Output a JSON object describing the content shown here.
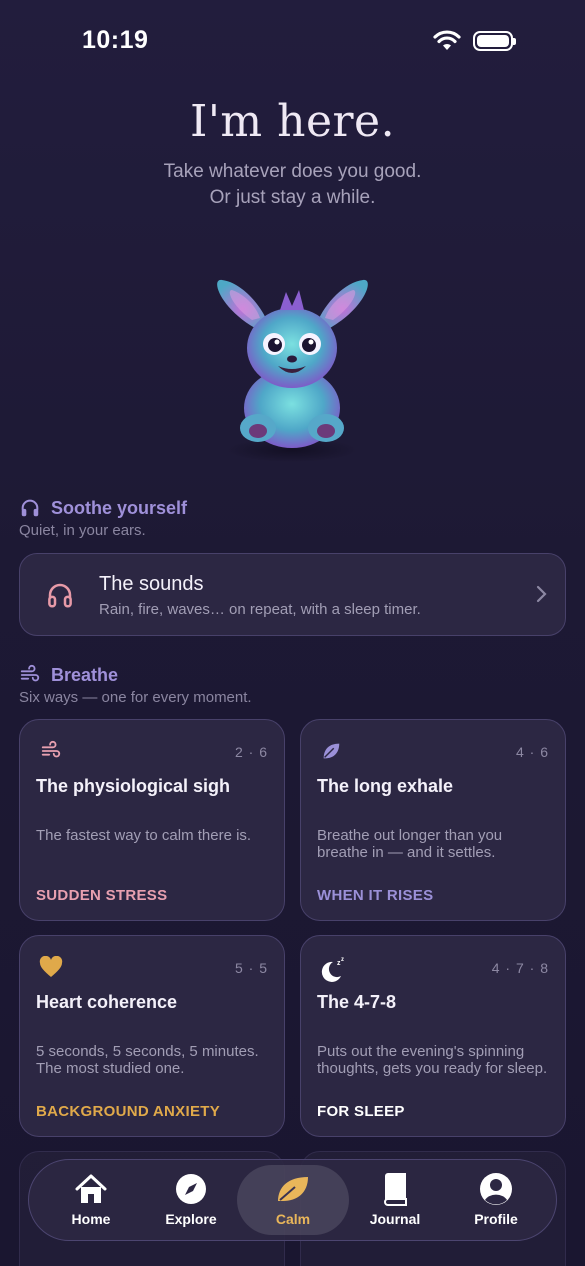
{
  "status": {
    "time": "10:19"
  },
  "hero": {
    "title": "I'm here.",
    "subtitle_line1": "Take whatever does you good.",
    "subtitle_line2": "Or just stay a while."
  },
  "soothe": {
    "title": "Soothe yourself",
    "subtitle": "Quiet, in your ears.",
    "card": {
      "title": "The sounds",
      "description": "Rain, fire, waves… on repeat, with a sleep timer."
    }
  },
  "breathe": {
    "title": "Breathe",
    "subtitle": "Six ways — one for every moment.",
    "cards": [
      {
        "icon": "wind-icon",
        "pattern": "2 · 6",
        "title": "The physiological sigh",
        "description": "The fastest way to calm there is.",
        "tag": "SUDDEN STRESS",
        "tag_color": "#e8a0b0"
      },
      {
        "icon": "leaf-icon",
        "pattern": "4 · 6",
        "title": "The long exhale",
        "description": "Breathe out longer than you breathe in — and it settles.",
        "tag": "WHEN IT RISES",
        "tag_color": "#9b90d8"
      },
      {
        "icon": "heart-icon",
        "pattern": "5 · 5",
        "title": "Heart coherence",
        "description": "5 seconds, 5 seconds, 5 minutes. The most studied one.",
        "tag": "BACKGROUND ANXIETY",
        "tag_color": "#e0a94a"
      },
      {
        "icon": "moon-icon",
        "pattern": "4 · 7 · 8",
        "title": "The 4-7-8",
        "description": "Puts out the evening's spinning thoughts, gets you ready for sleep.",
        "tag": "FOR SLEEP",
        "tag_color": "#ffffff"
      }
    ]
  },
  "tabs": [
    {
      "label": "Home",
      "icon": "home-icon"
    },
    {
      "label": "Explore",
      "icon": "compass-icon"
    },
    {
      "label": "Calm",
      "icon": "leaf-icon",
      "active": true
    },
    {
      "label": "Journal",
      "icon": "book-icon"
    },
    {
      "label": "Profile",
      "icon": "profile-icon"
    }
  ],
  "colors": {
    "accent": "#9f90d9",
    "active_tab": "#e9b65a",
    "background": "#1e1a35"
  }
}
